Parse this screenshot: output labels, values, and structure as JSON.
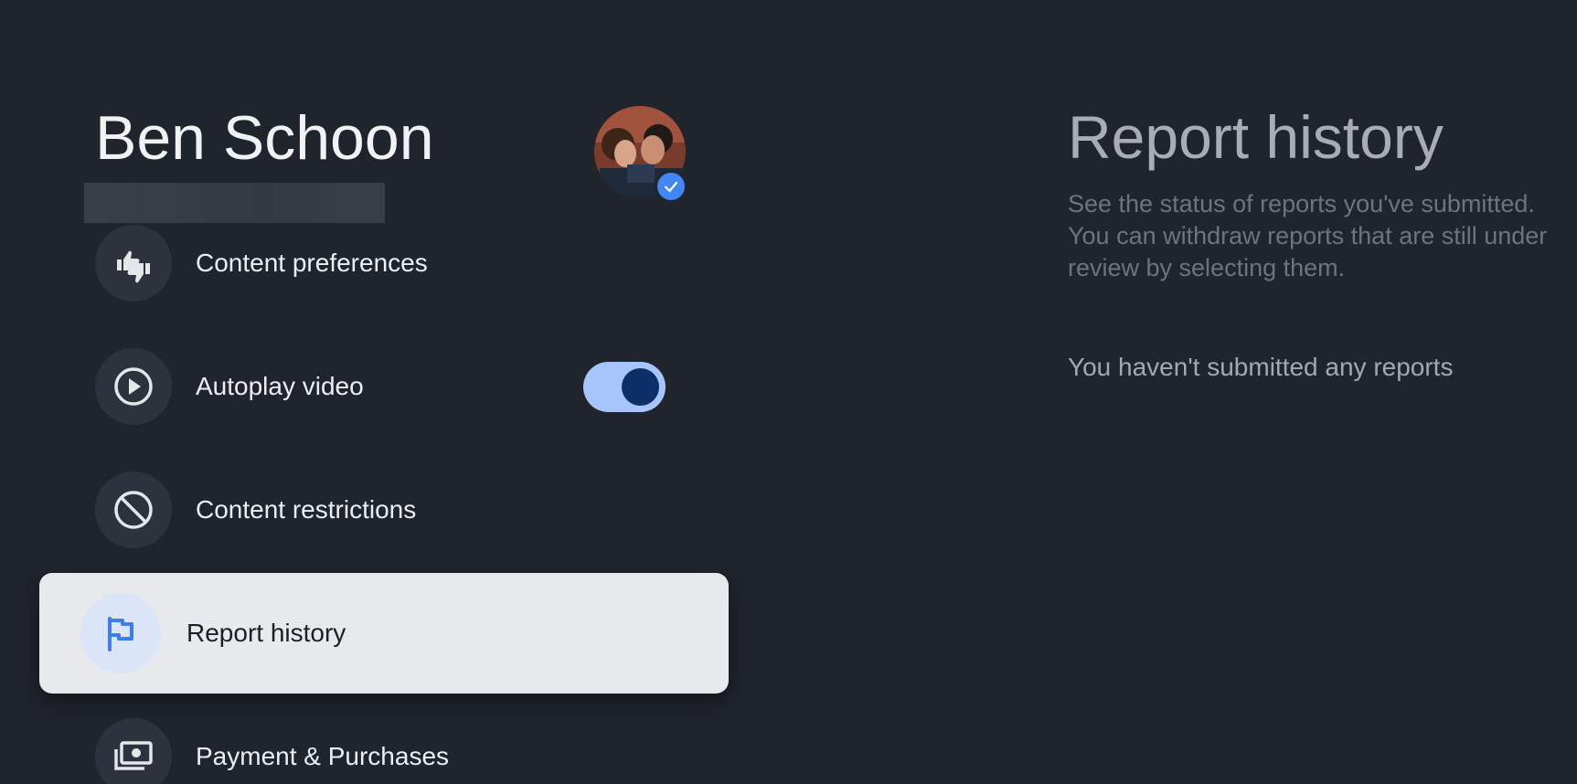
{
  "profile": {
    "name": "Ben Schoon"
  },
  "menu": {
    "items": [
      {
        "label": "Content preferences",
        "icon": "thumbs-up-down-icon"
      },
      {
        "label": "Autoplay video",
        "icon": "play-circle-icon",
        "toggle_on": true
      },
      {
        "label": "Content restrictions",
        "icon": "block-icon"
      },
      {
        "label": "Report history",
        "icon": "flag-icon",
        "selected": true
      },
      {
        "label": "Payment & Purchases",
        "icon": "payments-icon"
      }
    ]
  },
  "detail": {
    "title": "Report history",
    "description": "See the status of reports you've submitted. You can withdraw reports that are still under review by selecting them.",
    "empty_message": "You haven't submitted any reports"
  },
  "colors": {
    "background": "#20242d",
    "accent": "#4285f4",
    "toggle_track": "#a8c5fb",
    "toggle_knob": "#0c2f67",
    "selected_card": "#e8e9ed"
  }
}
